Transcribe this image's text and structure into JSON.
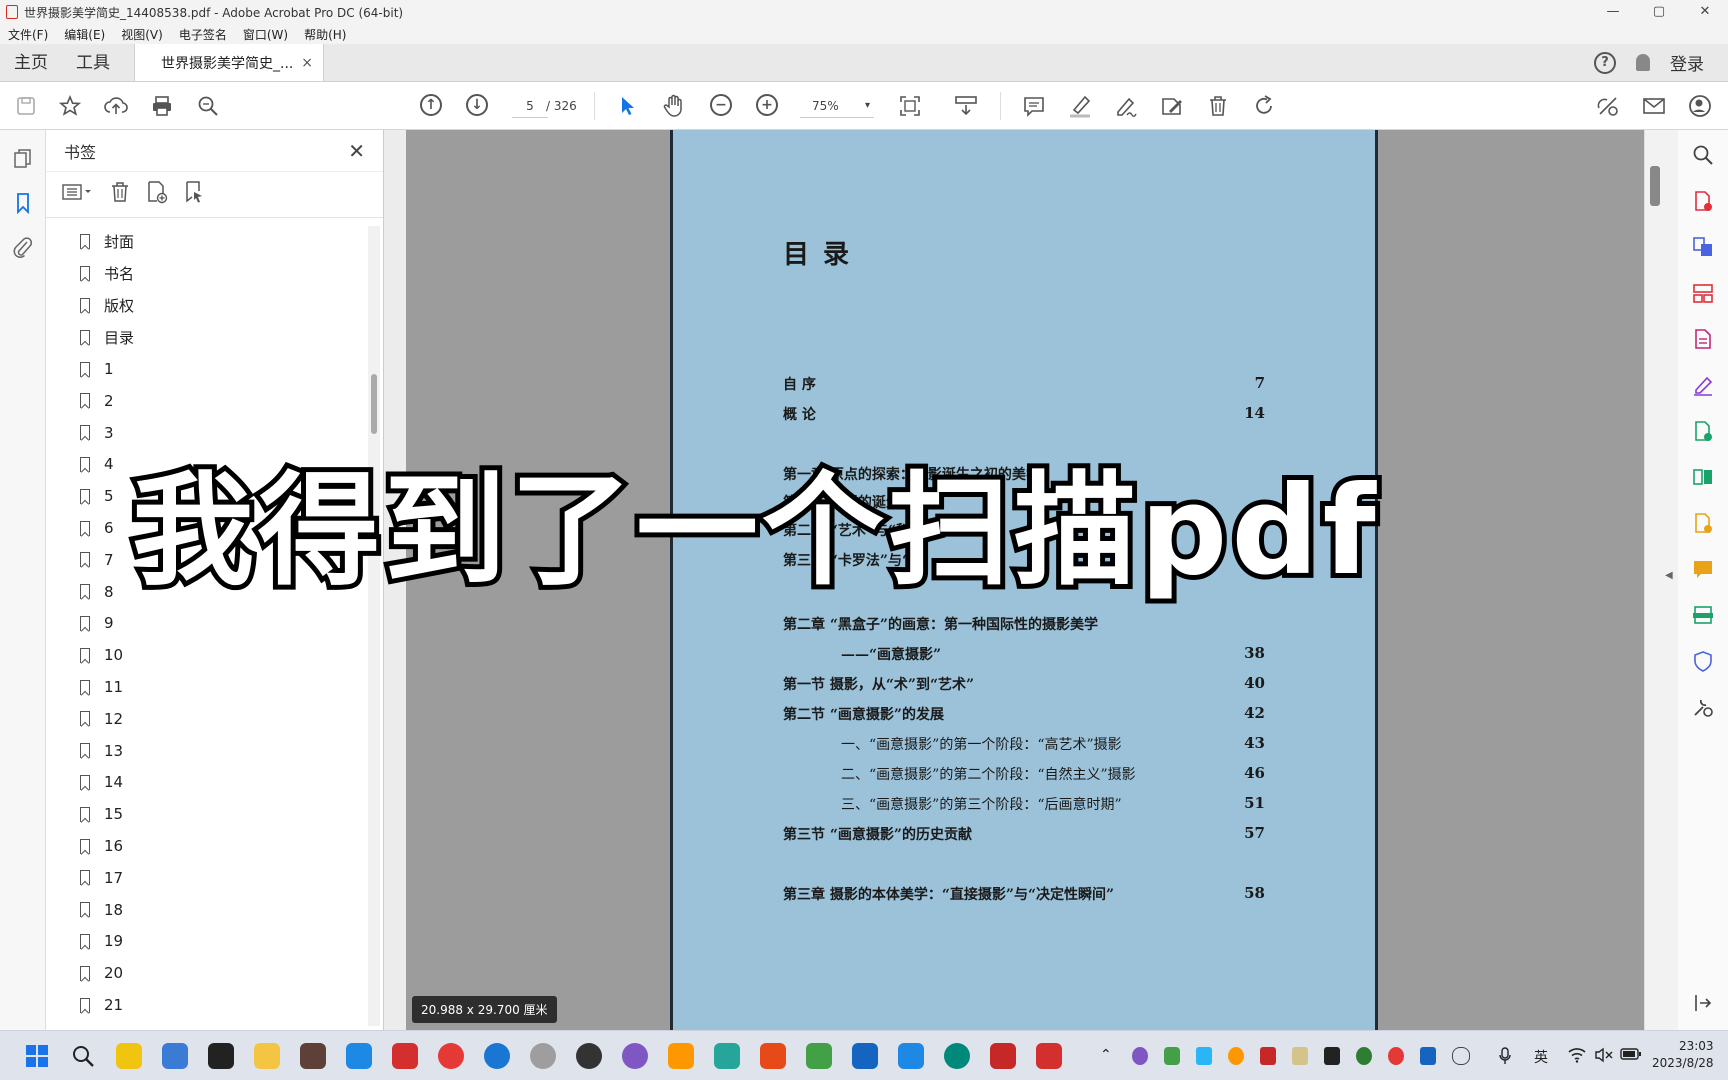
{
  "window": {
    "title": "世界摄影美学简史_14408538.pdf - Adobe Acrobat Pro DC (64-bit)",
    "controls": [
      "—",
      "▢",
      "✕"
    ]
  },
  "menu": [
    "文件(F)",
    "编辑(E)",
    "视图(V)",
    "电子签名",
    "窗口(W)",
    "帮助(H)"
  ],
  "tabs": {
    "home": "主页",
    "tools": "工具",
    "document": "世界摄影美学简史_...",
    "close": "×",
    "help": "?",
    "login": "登录"
  },
  "toolbar": {
    "page_current": "5",
    "page_total": "/ 326",
    "zoom": "75%",
    "zoom_caret": "▾"
  },
  "bookmarks": {
    "title": "书签",
    "close": "✕",
    "items": [
      "封面",
      "书名",
      "版权",
      "目录",
      "1",
      "2",
      "3",
      "4",
      "5",
      "6",
      "7",
      "8",
      "9",
      "10",
      "11",
      "12",
      "13",
      "14",
      "15",
      "16",
      "17",
      "18",
      "19",
      "20",
      "21"
    ]
  },
  "page": {
    "toc_title": "目录",
    "entries": [
      {
        "label": "自  序",
        "page": "7"
      },
      {
        "label": "概  论",
        "page": "14"
      },
      {
        "label": "第一章  原点的探索：摄影诞生之初的美学",
        "page": ""
      },
      {
        "label": "第一节  摄影的诞生",
        "page": ""
      },
      {
        "label": "第二节  “艺术”与“科学”的不同",
        "page": ""
      },
      {
        "label": "第三节  “卡罗法”与“美",
        "page": ""
      },
      {
        "label": "第二章  “黑盒子”的画意：第一种国际性的摄影美学",
        "page": ""
      },
      {
        "label": "——“画意摄影”",
        "page": "38"
      },
      {
        "label": "第一节  摄影，从“术”到“艺术”",
        "page": "40"
      },
      {
        "label": "第二节  “画意摄影”的发展",
        "page": "42"
      },
      {
        "label": "一、“画意摄影”的第一个阶段：“高艺术”摄影",
        "page": "43"
      },
      {
        "label": "二、“画意摄影”的第二个阶段：“自然主义”摄影",
        "page": "46"
      },
      {
        "label": "三、“画意摄影”的第三个阶段：“后画意时期”",
        "page": "51"
      },
      {
        "label": "第三节  “画意摄影”的历史贡献",
        "page": "57"
      },
      {
        "label": "第三章  摄影的本体美学：“直接摄影”与“决定性瞬间”",
        "page": "58"
      }
    ]
  },
  "page_size_tip": "20.988 x 29.700 厘米",
  "overlay_caption": "我得到了一个扫描pdf",
  "taskbar": {
    "ime": "英",
    "time": "23:03",
    "date": "2023/8/28"
  }
}
